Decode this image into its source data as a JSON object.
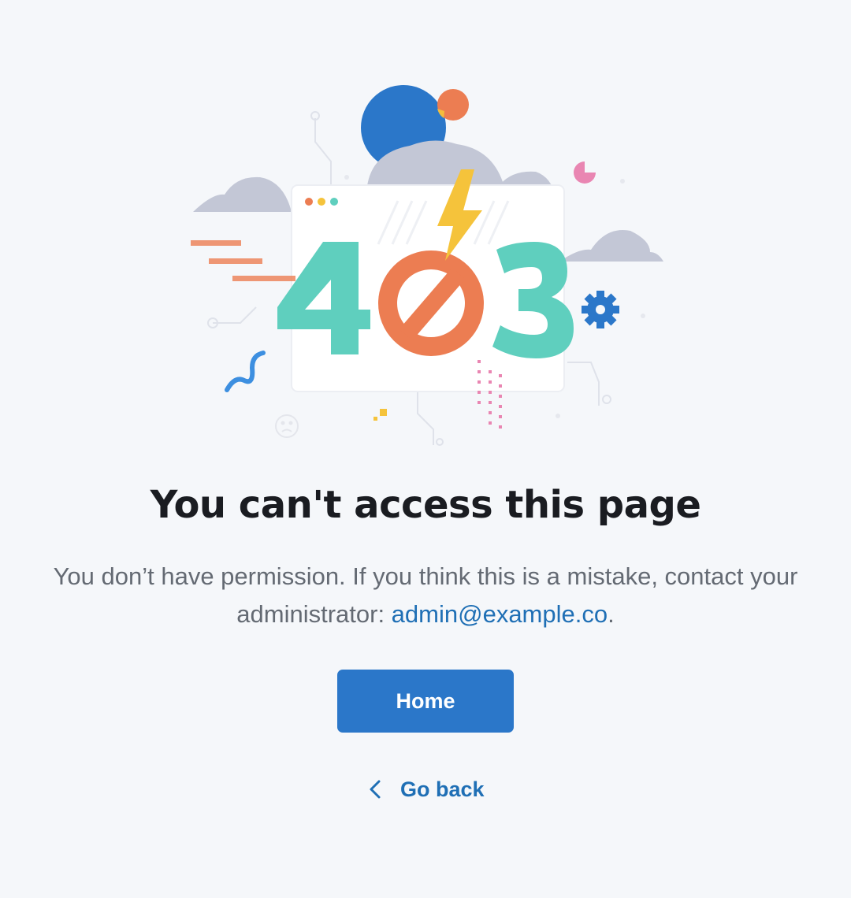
{
  "illustration": {
    "code": "403",
    "icons": [
      "cloud-icon",
      "lightning-bolt-icon",
      "prohibited-icon",
      "gear-icon",
      "browser-window-icon",
      "sad-face-icon"
    ],
    "colors": {
      "teal": "#5fcfbe",
      "orange": "#ec7d52",
      "blue": "#2b77c9",
      "yellow": "#f5c33b",
      "pink": "#e986b2",
      "cloud": "#c3c7d6"
    }
  },
  "page": {
    "title": "You can't access this page",
    "message_prefix": "You don’t have permission. If you think this is a mistake, contact your administrator: ",
    "admin_email": "admin@example.co",
    "message_suffix": ".",
    "home_label": "Home",
    "back_label": "Go back",
    "back_icon": "chevron-left-icon"
  },
  "colors": {
    "background": "#f5f7fa",
    "primary": "#2b77c9",
    "link": "#1f6fb5",
    "title": "#1a1c21",
    "text": "#646a73"
  }
}
